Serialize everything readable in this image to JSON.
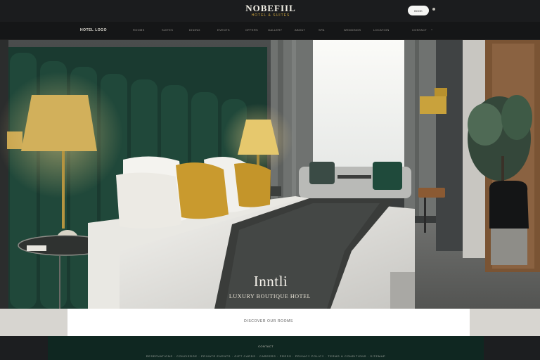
{
  "header": {
    "logo_main": "NOBEFIIL",
    "logo_sub": "HOTEL & SUITES",
    "book_button": "BOOK",
    "user_icon": "dot-icon"
  },
  "nav": {
    "brand": "HOTEL LOGO",
    "items": [
      "ROOMS",
      "SUITES",
      "DINING",
      "EVENTS",
      "OFFERS",
      "GALLERY",
      "ABOUT",
      "SPA",
      "WEDDINGS",
      "LOCATION",
      "CONTACT"
    ],
    "more_icon": "chevron-down-icon"
  },
  "hero": {
    "title": "Inntli",
    "subtitle": "LUXURY BOUTIQUE HOTEL"
  },
  "strip": {
    "text": "DISCOVER OUR ROOMS"
  },
  "footer": {
    "heading": "CONTACT",
    "text": "RESERVATIONS · CONCIERGE · PRIVATE EVENTS · GIFT CARDS · CAREERS · PRESS · PRIVACY POLICY · TERMS & CONDITIONS · SITEMAP"
  },
  "colors": {
    "velvet_green": "#1e4a3c",
    "brass": "#c9a23c",
    "mustard_pillow": "#c99a2e",
    "top_bar": "#1b1c1e",
    "footer": "#0f2721"
  }
}
